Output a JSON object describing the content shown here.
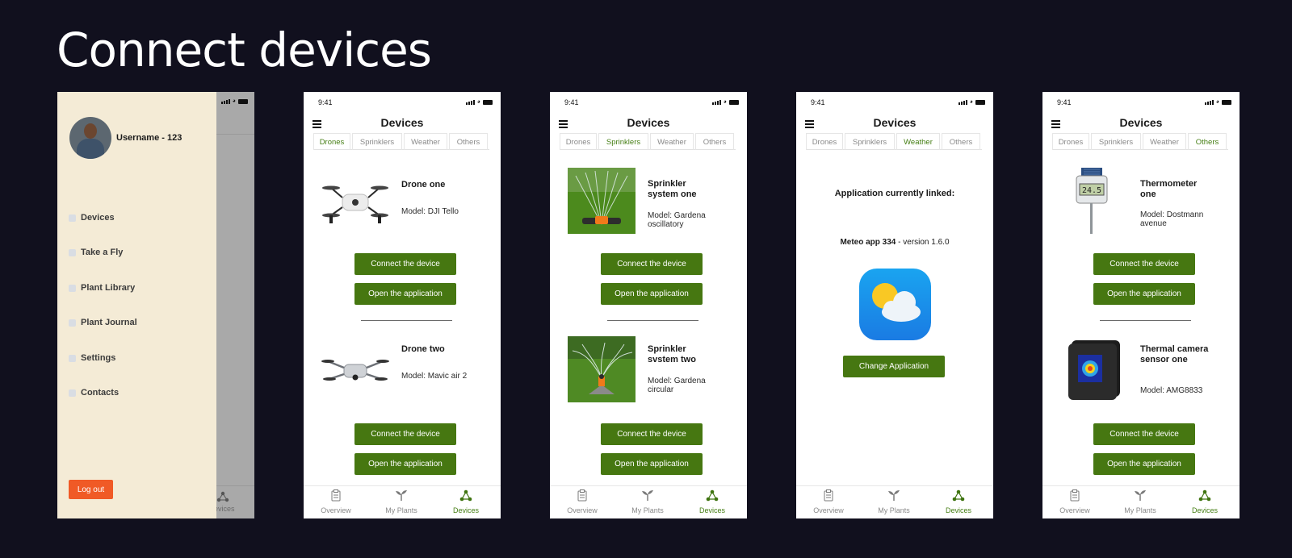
{
  "page_title": "Connect devices",
  "status_time": "9:41",
  "screen_title": "Devices",
  "tabs": [
    "Drones",
    "Sprinklers",
    "Weather",
    "Others"
  ],
  "nav": [
    "Overview",
    "My Plants",
    "Devices"
  ],
  "buttons": {
    "connect": "Connect the device",
    "open_app": "Open the application",
    "change_app": "Change Application"
  },
  "menu": {
    "username": "Username - 123",
    "items": [
      "Devices",
      "Take a Fly",
      "Plant Library",
      "Plant Journal",
      "Settings",
      "Contacts"
    ],
    "logout": "Log out",
    "behind_nav_label": "evices"
  },
  "drones": [
    {
      "title": "Drone one",
      "model": "Model: DJI Tello"
    },
    {
      "title": "Drone two",
      "model": "Model: Mavic air 2"
    }
  ],
  "sprinklers": [
    {
      "title": "Sprinkler system one",
      "model": "Model: Gardena oscillatory"
    },
    {
      "title": "Sprinkler svstem two",
      "model": "Model: Gardena circular"
    }
  ],
  "weather": {
    "linked_title": "Application currently linked:",
    "app_name": "Meteo app 334",
    "app_version": " - version 1.6.0"
  },
  "others": [
    {
      "title": "Thermometer one",
      "model": "Model: Dostmann avenue"
    },
    {
      "title": "Thermal camera sensor one",
      "model": "Model: AMG8833"
    }
  ],
  "thermometer_display": "24.5"
}
